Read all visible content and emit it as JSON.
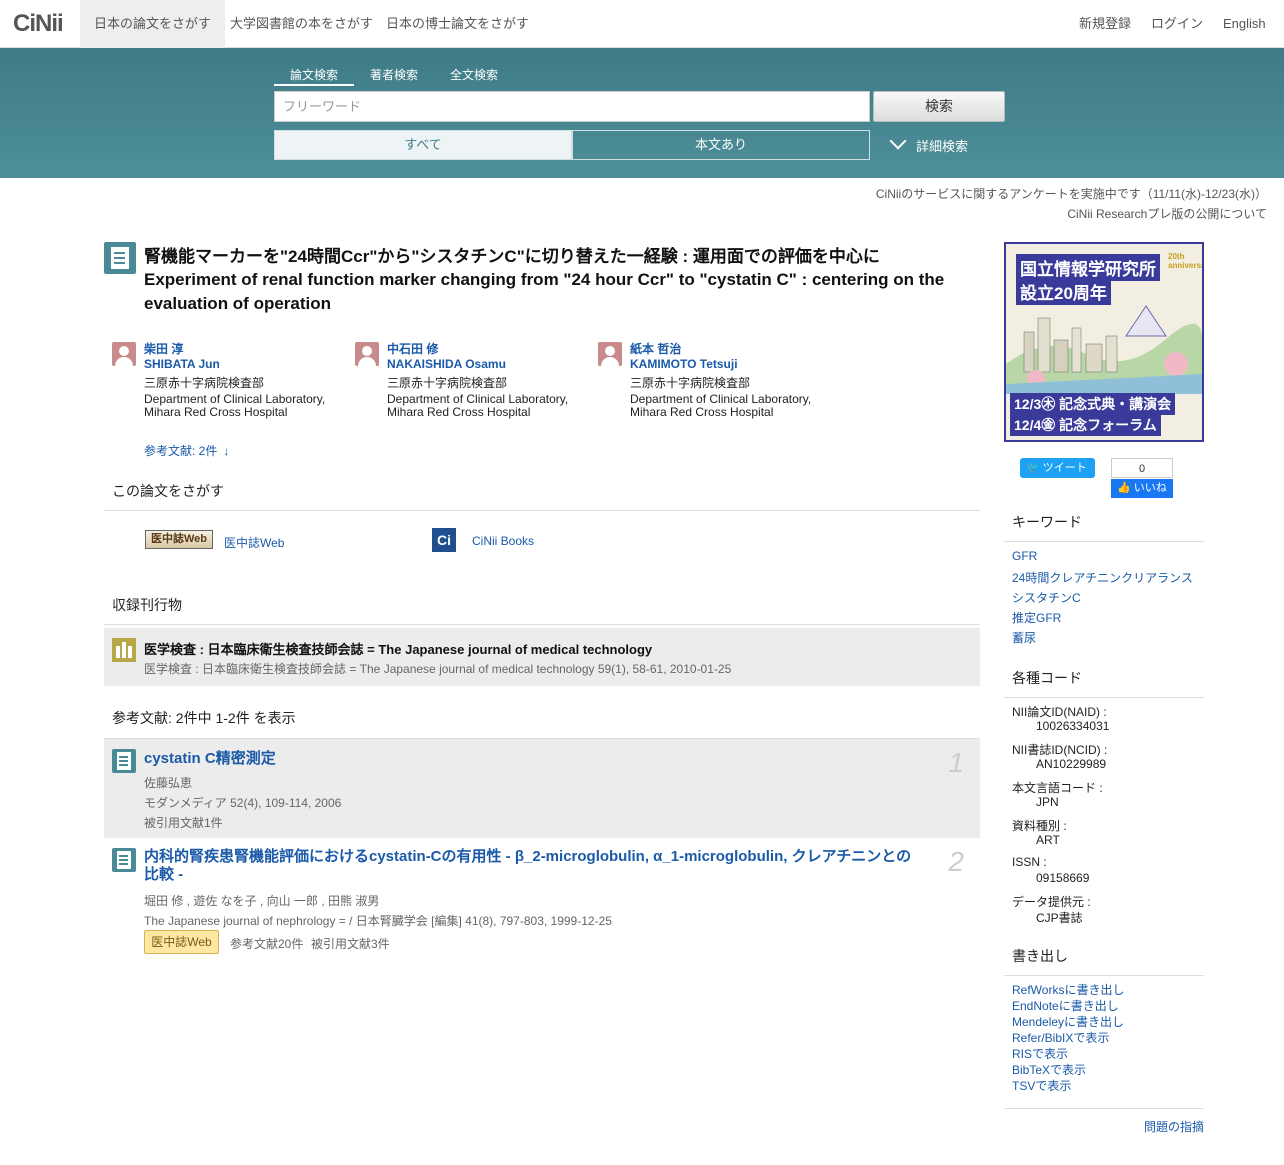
{
  "nav": {
    "logo": "CiNii",
    "tabs": [
      "日本の論文をさがす",
      "大学図書館の本をさがす",
      "日本の博士論文をさがす"
    ],
    "right": [
      "新規登録",
      "ログイン",
      "English"
    ]
  },
  "search": {
    "tabs": [
      "論文検索",
      "著者検索",
      "全文検索"
    ],
    "placeholder": "フリーワード",
    "button": "検索",
    "filter_all": "すべて",
    "filter_fulltext": "本文あり",
    "advanced": "詳細検索"
  },
  "notices": [
    "CiNiiのサービスに関するアンケートを実施中です（11/11(水)-12/23(水)）",
    "CiNii Researchプレ版の公開について"
  ],
  "article": {
    "title_ja": "腎機能マーカーを\"24時間Ccr\"から\"シスタチンC\"に切り替えた一経験 : 運用面での評価を中心に",
    "title_en": "Experiment of renal function marker changing from \"24 hour Ccr\" to \"cystatin C\" : centering on the evaluation of operation",
    "authors": [
      {
        "name_ja": "柴田 淳",
        "name_en": "SHIBATA Jun",
        "aff_ja": "三原赤十字病院検査部",
        "aff_en1": "Department of Clinical Laboratory,",
        "aff_en2": "Mihara Red Cross Hospital"
      },
      {
        "name_ja": "中石田 修",
        "name_en": "NAKAISHIDA Osamu",
        "aff_ja": "三原赤十字病院検査部",
        "aff_en1": "Department of Clinical Laboratory,",
        "aff_en2": "Mihara Red Cross Hospital"
      },
      {
        "name_ja": "紙本 哲治",
        "name_en": "KAMIMOTO Tetsuji",
        "aff_ja": "三原赤十字病院検査部",
        "aff_en1": "Department of Clinical Laboratory,",
        "aff_en2": "Mihara Red Cross Hospital"
      }
    ],
    "ref_count": "参考文献: 2件"
  },
  "search_this": {
    "heading": "この論文をさがす",
    "ichushi_logo": "医中誌Web",
    "ichushi_label": "医中誌Web",
    "cinii_books": "CiNii Books"
  },
  "journal": {
    "heading": "収録刊行物",
    "title": "医学検査 : 日本臨床衛生検査技師会誌 = The Japanese journal of medical technology",
    "sub": "医学検査 : 日本臨床衛生検査技師会誌 = The Japanese journal of medical technology 59(1), 58-61, 2010-01-25"
  },
  "references": {
    "label": "参考文献:  2件中 1-2件 を表示",
    "items": [
      {
        "num": "1",
        "title": "cystatin C精密測定",
        "author": "佐藤弘恵",
        "source": "モダンメディア 52(4), 109-114, 2006",
        "cited": "被引用文献1件"
      },
      {
        "num": "2",
        "title": "内科的腎疾患腎機能評価におけるcystatin-Cの有用性 - β_2-microglobulin, α_1-microglobulin, クレアチニンとの比較 -",
        "author": "堀田 修 , 遊佐 なを子 , 向山 一郎 , 田熊 淑男",
        "source": "The Japanese journal of nephrology = / 日本腎臓学会 [編集] 41(8), 797-803, 1999-12-25",
        "badge": "医中誌Web",
        "refs": "参考文献20件",
        "cited": "被引用文献3件"
      }
    ]
  },
  "banner": {
    "line1": "国立情報学研究所",
    "line2": "設立20周年",
    "anniv": "20th anniversary",
    "event1": "12/3㊍ 記念式典・講演会",
    "event2": "12/4㊎ 記念フォーラム"
  },
  "social": {
    "tweet": "ツイート",
    "like_count": "0",
    "like": "いいね"
  },
  "keywords": {
    "heading": "キーワード",
    "items": [
      "GFR",
      "24時間クレアチニンクリアランス",
      "シスタチンC",
      "推定GFR",
      "蓄尿"
    ]
  },
  "codes": {
    "heading": "各種コード",
    "items": [
      {
        "label": "NII論文ID(NAID) :",
        "value": "10026334031"
      },
      {
        "label": "NII書誌ID(NCID) :",
        "value": "AN10229989"
      },
      {
        "label": "本文言語コード :",
        "value": "JPN"
      },
      {
        "label": "資料種別 :",
        "value": "ART"
      },
      {
        "label": "ISSN :",
        "value": "09158669"
      },
      {
        "label": "データ提供元 :",
        "value": "CJP書誌"
      }
    ]
  },
  "export": {
    "heading": "書き出し",
    "items": [
      "RefWorksに書き出し",
      "EndNoteに書き出し",
      "Mendeleyに書き出し",
      "Refer/BibIXで表示",
      "RISで表示",
      "BibTeXで表示",
      "TSVで表示"
    ]
  },
  "report": "問題の指摘",
  "colors": {
    "accent": "#3e7b86",
    "link": "#1a5aa8",
    "journal_icon": "#b9a84a"
  }
}
